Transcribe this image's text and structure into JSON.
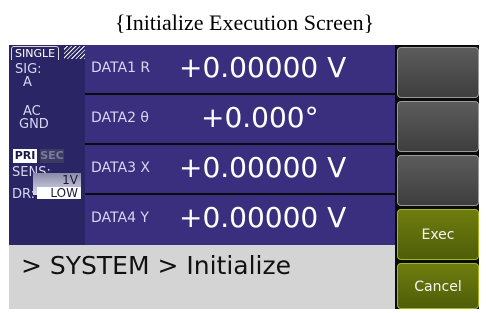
{
  "caption": "{Initialize Execution Screen}",
  "left_panel": {
    "mode_tab": "SINGLE",
    "sig_label": "SIG:",
    "sig_value": "A",
    "coupling": "AC",
    "ground": "GND",
    "pri": "PRI",
    "sec": "SEC",
    "sens_label": "SENS:",
    "sens_value": "1V",
    "dr_label": "DR:",
    "dr_value": "LOW"
  },
  "rows": [
    {
      "name": "DATA1  R",
      "value": "+0.00000  V"
    },
    {
      "name": "DATA2  θ",
      "value": "+0.000°"
    },
    {
      "name": "DATA3  X",
      "value": "+0.00000  V"
    },
    {
      "name": "DATA4  Y",
      "value": "+0.00000  V"
    }
  ],
  "message": "> SYSTEM > Initialize",
  "buttons": {
    "exec": "Exec",
    "cancel": "Cancel"
  },
  "colors": {
    "panel_bg": "#2a2666",
    "row_bg": "#3a2f7e",
    "button_gray": "#4a4a4a",
    "button_green": "#5f6e0c",
    "message_bg": "#d4d4d4"
  }
}
